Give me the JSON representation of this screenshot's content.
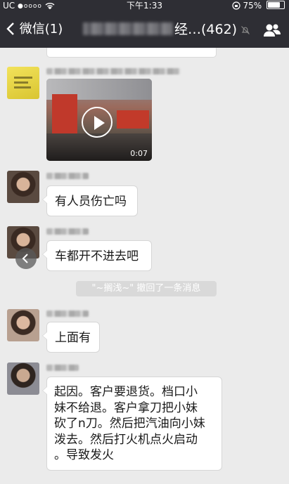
{
  "statusbar": {
    "carrier": "UC",
    "signal": "●oooo",
    "time": "下午1:33",
    "battery": "75%",
    "battery_level": 0.75
  },
  "navbar": {
    "back_label": "微信(1)",
    "title_suffix": "经…(462)"
  },
  "messages": [
    {
      "type": "video",
      "duration": "0:07"
    },
    {
      "type": "text",
      "text": "有人员伤亡吗"
    },
    {
      "type": "text",
      "text": "车都开不进去吧"
    },
    {
      "type": "text",
      "text": "上面有"
    },
    {
      "type": "text",
      "lines": [
        "起因。客户要退货。档口小",
        "妹不给退。客户拿刀把小妹",
        "砍了n刀。然后把汽油向小妹",
        "泼去。然后打火机点火启动",
        "。导致发火"
      ]
    }
  ],
  "system_note": "\"~搁浅~\" 撤回了一条消息",
  "colors": {
    "navbar": "#2e2e34",
    "chat_bg": "#ebebeb",
    "bubble": "#ffffff",
    "note_bg": "#d9d9d9"
  }
}
